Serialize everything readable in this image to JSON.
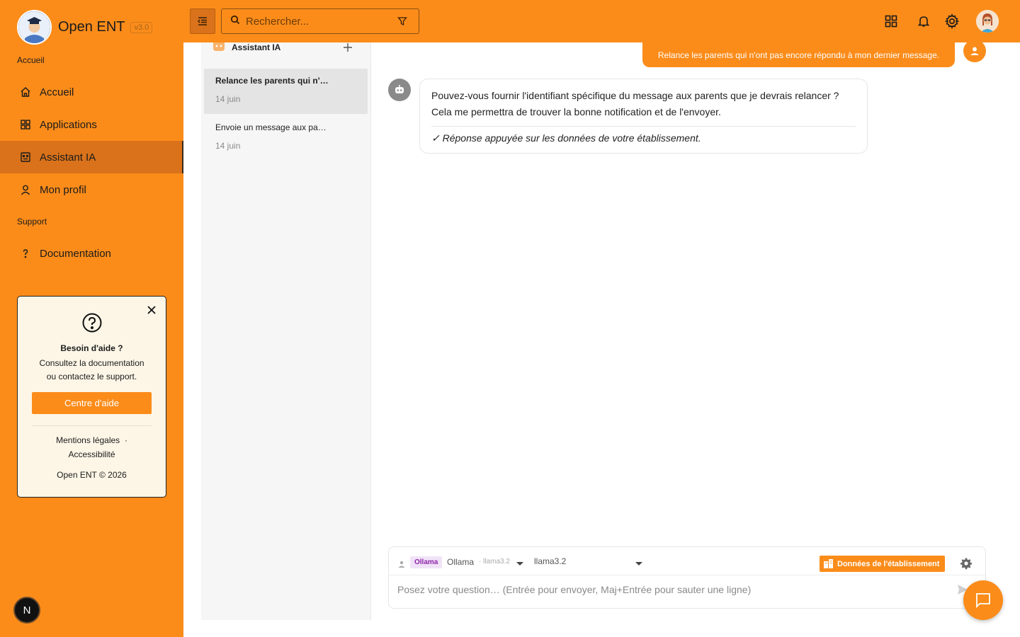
{
  "app": {
    "name": "Open ENT",
    "version": "v3.0"
  },
  "colors": {
    "accent": "#fb8c1a",
    "accent_dark": "#d9721a",
    "badge_purple": "#8e24aa"
  },
  "sidebar": {
    "section_home": "Accueil",
    "section_support": "Support",
    "items": [
      {
        "label": "Accueil",
        "icon": "home-icon"
      },
      {
        "label": "Applications",
        "icon": "apps-grid-icon"
      },
      {
        "label": "Assistant IA",
        "icon": "robot-icon",
        "active": true
      },
      {
        "label": "Mon profil",
        "icon": "user-icon"
      }
    ],
    "support_items": [
      {
        "label": "Documentation",
        "icon": "question-icon"
      }
    ],
    "help_card": {
      "title": "Besoin d'aide ?",
      "line1": "Consultez la documentation",
      "line2": "ou contactez le support.",
      "button": "Centre d'aide",
      "link_legal": "Mentions légales",
      "separator": "·",
      "link_access": "Accessibilité",
      "copyright": "Open ENT © 2026"
    },
    "badge_letter": "N"
  },
  "topbar": {
    "search_placeholder": "Rechercher..."
  },
  "conversations": {
    "title": "Assistant IA",
    "items": [
      {
        "title": "Relance les parents qui n'…",
        "date": "14 juin",
        "active": true
      },
      {
        "title": "Envoie un message aux pa…",
        "date": "14 juin",
        "active": false
      }
    ]
  },
  "chat": {
    "user_message": "Relance les parents qui n'ont pas encore répondu à mon dernier message.",
    "bot_line1": "Pouvez-vous fournir l'identifiant spécifique du message aux parents que je devrais relancer ?",
    "bot_line2": "Cela me permettra de trouver la bonne notification et de l'envoyer.",
    "bot_note": "✓ Réponse appuyée sur les données de votre établissement."
  },
  "composer": {
    "provider_badge": "Ollama",
    "provider_name": "Ollama",
    "provider_model": "· llama3.2",
    "model_select": "llama3.2",
    "data_button": "Données de l'établissement",
    "placeholder": "Posez votre question… (Entrée pour envoyer, Maj+Entrée pour sauter une ligne)"
  }
}
